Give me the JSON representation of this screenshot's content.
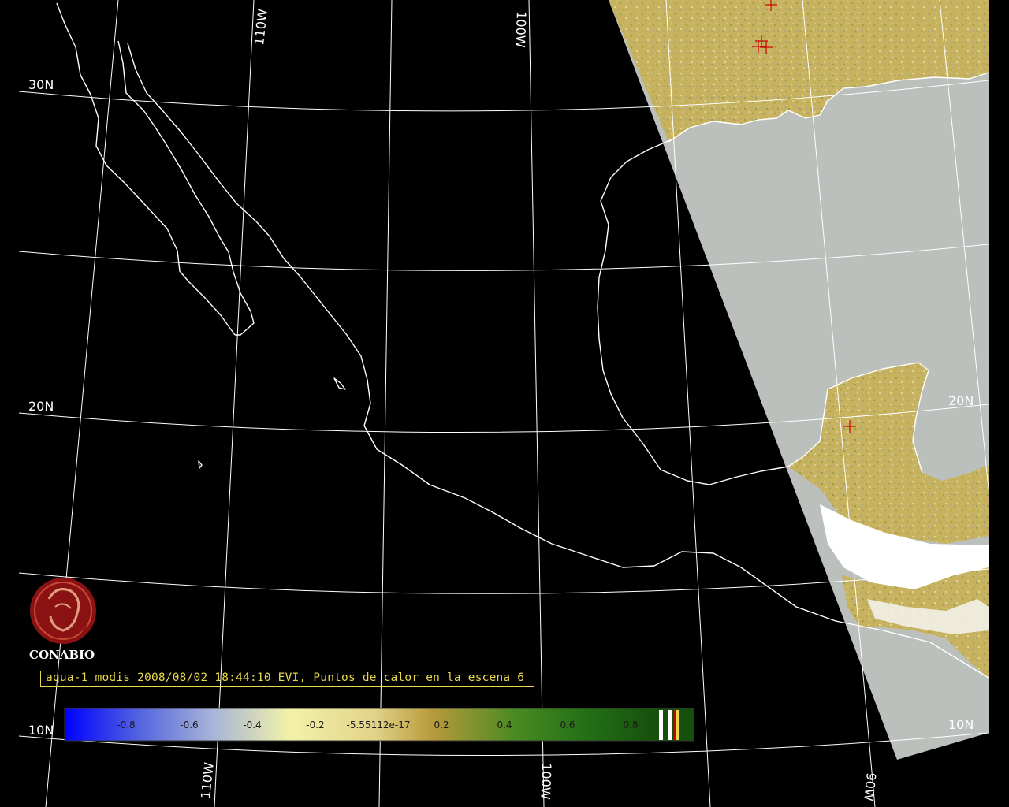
{
  "map": {
    "graticule_labels": {
      "lat_30": "30N",
      "lat_20_left": "20N",
      "lat_20_right": "20N",
      "lat_10_left": "10N",
      "lat_10_right": "10N",
      "lon_110_top": "110W",
      "lon_100_top": "100W",
      "lon_110_bottom": "110W",
      "lon_100_bottom": "100W",
      "lon_90_bottom": "90W"
    },
    "colors": {
      "background": "#000000",
      "coastline": "#ffffff",
      "graticule": "#ffffff",
      "swath_no_data": "#bcc0bc",
      "vegetation": "#c9b45e",
      "cloud": "#ffffff",
      "hotspot": "#cc0000"
    },
    "hotspots_count": 6
  },
  "logo": {
    "name": "CONABIO",
    "emblem": "conabio-seal-icon"
  },
  "caption": {
    "text": "aqua-1 modis 2008/08/02 18:44:10 EVI, Puntos de calor en la escena 6"
  },
  "colorbar": {
    "ticks": [
      "-0.8",
      "-0.6",
      "-0.4",
      "-0.2",
      "-5.55112e-17",
      "0.2",
      "0.4",
      "0.6",
      "0.8"
    ],
    "stops": [
      "#0000ff",
      "#9aa6d6",
      "#eeeea0",
      "#e6d88a",
      "#c8b060",
      "#9a9a3a",
      "#3d8a1e",
      "#1f6a12",
      "#114a0a"
    ]
  }
}
